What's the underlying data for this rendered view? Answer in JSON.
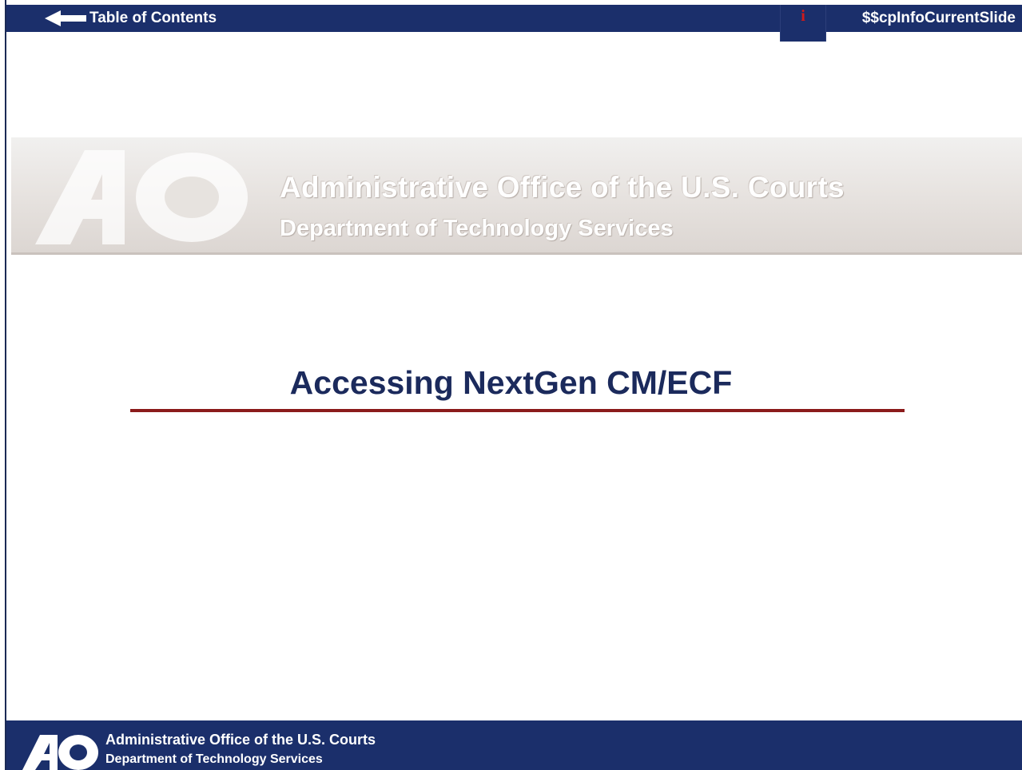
{
  "topbar": {
    "toc_label": "Table of Contents",
    "info_glyph": "i",
    "slide_counter": "$$cpInfoCurrentSlide"
  },
  "banner": {
    "title": "Administrative Office of the U.S. Courts",
    "subtitle": "Department of Technology Services",
    "logo_text": "AO"
  },
  "slide": {
    "title": "Accessing NextGen CM/ECF"
  },
  "footer": {
    "line1": "Administrative Office of the U.S. Courts",
    "line2": "Department of Technology Services",
    "logo_text": "AO"
  },
  "colors": {
    "nav_background": "#1b2f6b",
    "title_color": "#1b2a5c",
    "rule_color": "#8b1b1b",
    "info_icon_color": "#d11a1a"
  },
  "icons": {
    "toc": "arrow-left-icon",
    "info": "info-icon",
    "logo": "ao-logo"
  }
}
